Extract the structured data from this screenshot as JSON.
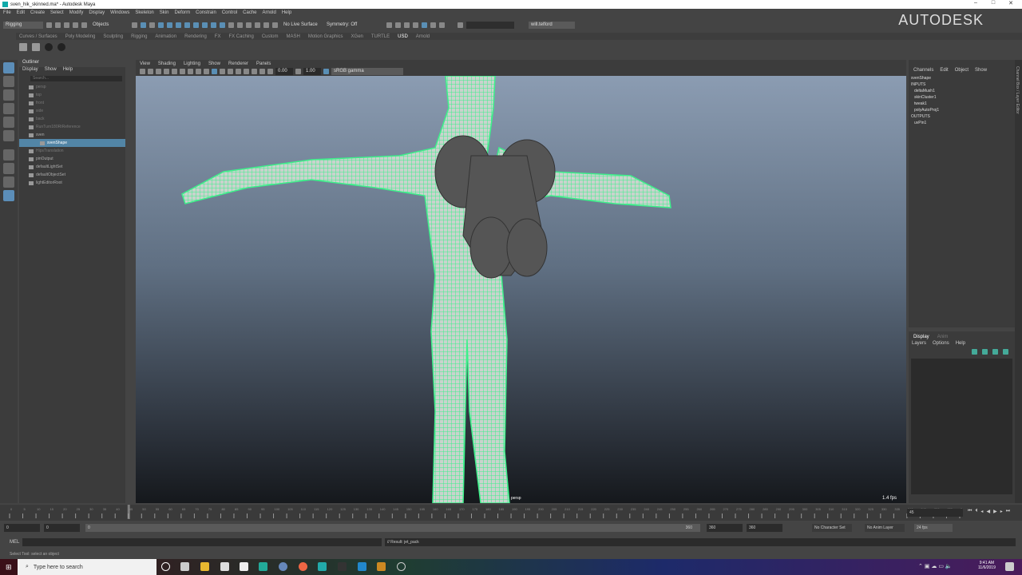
{
  "window": {
    "title": "sven_hik_skinned.ma* - Autodesk Maya",
    "brand": "AUTODESK"
  },
  "menu": [
    "File",
    "Edit",
    "Create",
    "Select",
    "Modify",
    "Display",
    "Windows",
    "Skeleton",
    "Skin",
    "Deform",
    "Constrain",
    "Control",
    "Cache",
    "Arnold",
    "Help"
  ],
  "toolbar": {
    "menuset": "Rigging",
    "objects": "Objects",
    "live_surface": "No Live Surface",
    "symmetry": "Symmetry: Off",
    "user": "will.telford"
  },
  "shelf_tabs": [
    "Curves / Surfaces",
    "Poly Modeling",
    "Sculpting",
    "Rigging",
    "Animation",
    "Rendering",
    "FX",
    "FX Caching",
    "Custom",
    "MASH",
    "Motion Graphics",
    "XGen",
    "TURTLE",
    "USD",
    "Arnold"
  ],
  "shelf_active": "USD",
  "outliner": {
    "title": "Outliner",
    "menu": [
      "Display",
      "Show",
      "Help"
    ],
    "search_placeholder": "Search...",
    "items": [
      {
        "label": "persp",
        "dim": true
      },
      {
        "label": "top",
        "dim": true
      },
      {
        "label": "front",
        "dim": true
      },
      {
        "label": "side",
        "dim": true
      },
      {
        "label": "back",
        "dim": true
      },
      {
        "label": "RunTurn180RtReference",
        "dim": true
      },
      {
        "label": "sven",
        "dim": false
      },
      {
        "label": "svenShape",
        "dim": false,
        "selected": true
      },
      {
        "label": "HipsTranslation",
        "dim": true
      },
      {
        "label": "pinOutput",
        "dim": false
      },
      {
        "label": "defaultLightSet",
        "dim": false
      },
      {
        "label": "defaultObjectSet",
        "dim": false
      },
      {
        "label": "lightEditorRoot",
        "dim": false
      }
    ]
  },
  "viewport": {
    "menu": [
      "View",
      "Shading",
      "Lighting",
      "Show",
      "Renderer",
      "Panels"
    ],
    "exposure": "0.00",
    "gamma": "1.00",
    "color_space": "sRGB gamma",
    "camera": "persp",
    "fps": "1.4 fps"
  },
  "channel_box": {
    "menu": [
      "Channels",
      "Edit",
      "Object",
      "Show"
    ],
    "node": "svenShape",
    "inputs_label": "INPUTS",
    "inputs": [
      "deltaMush1",
      "skinCluster1",
      "tweak1",
      "polyAutoProj1"
    ],
    "outputs_label": "OUTPUTS",
    "outputs": [
      "uvPin1"
    ],
    "side_tab": "Channel Box / Layer Editor"
  },
  "layer_editor": {
    "tabs": [
      "Display",
      "Anim"
    ],
    "menu": [
      "Layers",
      "Options",
      "Help"
    ]
  },
  "timeline": {
    "start": 0,
    "end": 360,
    "step": 5,
    "current_frame": "45"
  },
  "range": {
    "start": "0",
    "anim_start": "0",
    "slider_start": "0",
    "slider_end": "360",
    "anim_end": "360",
    "end": "360",
    "character_set": "No Character Set",
    "anim_layer": "No Anim Layer",
    "fps": "24 fps"
  },
  "command": {
    "lang": "MEL",
    "result": "// Result: jet_pack"
  },
  "help_line": "Select Tool: select an object",
  "taskbar": {
    "search_placeholder": "Type here to search",
    "time": "9:41 AM",
    "date": "11/6/2019"
  },
  "colors": {
    "wire": "#3cf08a",
    "selection": "#5285a6"
  }
}
